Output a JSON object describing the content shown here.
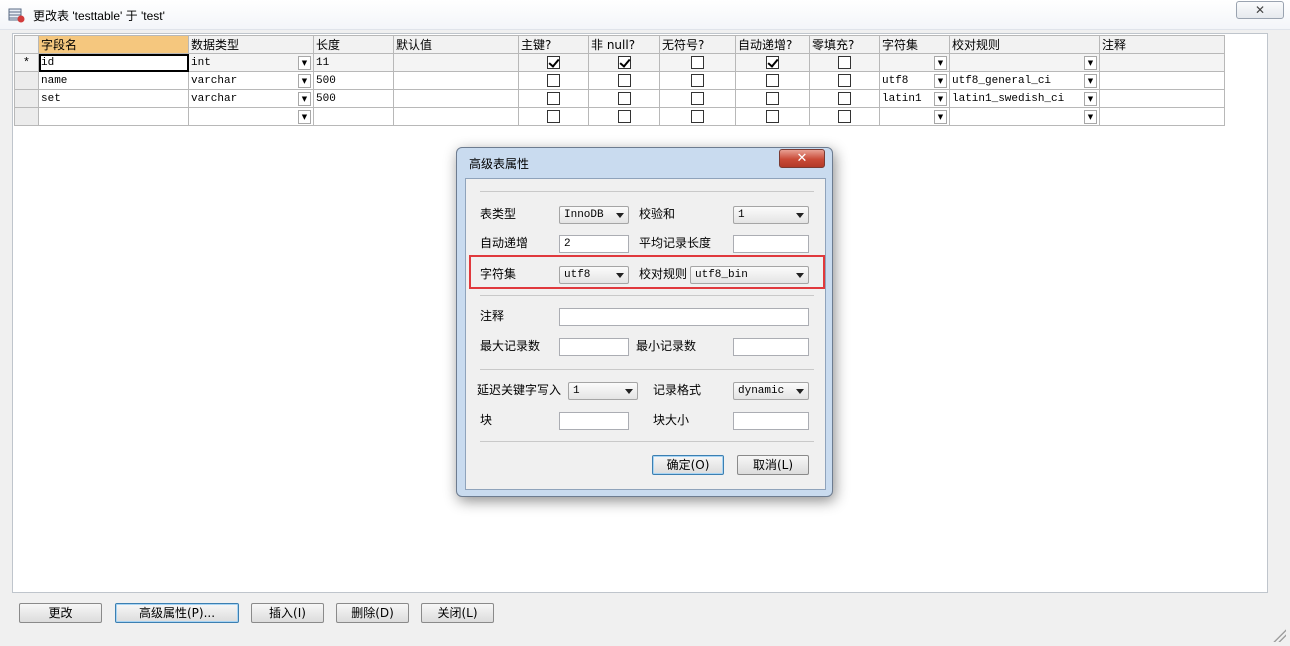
{
  "window": {
    "title": "更改表 'testtable' 于 'test'",
    "close_glyph": "✕"
  },
  "grid": {
    "columns": [
      "",
      "字段名",
      "数据类型",
      "长度",
      "默认值",
      "主键?",
      "非 null?",
      "无符号?",
      "自动递增?",
      "零填充?",
      "字符集",
      "校对规则",
      "注释"
    ],
    "rows": [
      {
        "marker": "*",
        "name": "id",
        "type": "int",
        "length": "11",
        "default": "",
        "pk": true,
        "notnull": true,
        "unsigned": false,
        "autoinc": true,
        "zerofill": false,
        "charset": "",
        "collation": "",
        "comment": ""
      },
      {
        "marker": "",
        "name": "name",
        "type": "varchar",
        "length": "500",
        "default": "",
        "pk": false,
        "notnull": false,
        "unsigned": false,
        "autoinc": false,
        "zerofill": false,
        "charset": "utf8",
        "collation": "utf8_general_ci",
        "comment": ""
      },
      {
        "marker": "",
        "name": "set",
        "type": "varchar",
        "length": "500",
        "default": "",
        "pk": false,
        "notnull": false,
        "unsigned": false,
        "autoinc": false,
        "zerofill": false,
        "charset": "latin1",
        "collation": "latin1_swedish_ci",
        "comment": ""
      },
      {
        "marker": "",
        "name": "",
        "type": "",
        "length": "",
        "default": "",
        "pk": false,
        "notnull": false,
        "unsigned": false,
        "autoinc": false,
        "zerofill": false,
        "charset": "",
        "collation": "",
        "comment": ""
      }
    ]
  },
  "buttons": {
    "alter": "更改",
    "advanced": "高级属性(P)...",
    "insert": "插入(I)",
    "delete": "删除(D)",
    "close": "关闭(L)"
  },
  "dialog": {
    "title": "高级表属性",
    "close_glyph": "✕",
    "table_type_label": "表类型",
    "table_type_value": "InnoDB",
    "checksum_label": "校验和",
    "checksum_value": "1",
    "auto_inc_label": "自动递增",
    "auto_inc_value": "2",
    "avg_row_label": "平均记录长度",
    "avg_row_value": "",
    "charset_label": "字符集",
    "charset_value": "utf8",
    "collation_label": "校对规则",
    "collation_value": "utf8_bin",
    "comment_label": "注释",
    "comment_value": "",
    "max_rows_label": "最大记录数",
    "max_rows_value": "",
    "min_rows_label": "最小记录数",
    "min_rows_value": "",
    "delay_key_label": "延迟关键字写入",
    "delay_key_value": "1",
    "row_format_label": "记录格式",
    "row_format_value": "dynamic",
    "block_label": "块",
    "block_value": "",
    "block_size_label": "块大小",
    "block_size_value": "",
    "ok_label": "确定(O)",
    "cancel_label": "取消(L)"
  },
  "colors": {
    "active_header": "#f5c77e",
    "dialog_frame": "#c9dbef",
    "highlight_box": "#e0393d"
  }
}
